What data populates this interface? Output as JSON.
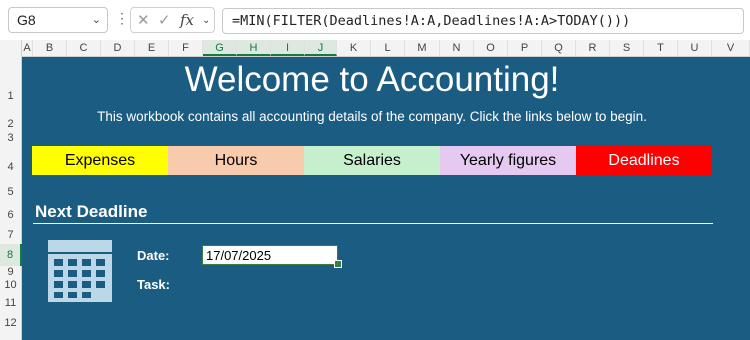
{
  "formula_bar": {
    "name_box": "G8",
    "formula": "=MIN(FILTER(Deadlines!A:A,Deadlines!A:A>TODAY()))"
  },
  "columns": [
    "A",
    "B",
    "C",
    "D",
    "E",
    "F",
    "G",
    "H",
    "I",
    "J",
    "K",
    "L",
    "M",
    "N",
    "O",
    "P",
    "Q",
    "R",
    "S",
    "T",
    "U",
    "V"
  ],
  "rows": [
    "1",
    "2",
    "3",
    "4",
    "5",
    "6",
    "7",
    "8",
    "9",
    "10",
    "11",
    "12"
  ],
  "sheet": {
    "title": "Welcome to Accounting!",
    "subtitle": "This workbook contains all accounting details of the company. Click the links below to begin.",
    "links": [
      {
        "label": "Expenses",
        "bg": "#ffff00",
        "color": "#000000"
      },
      {
        "label": "Hours",
        "bg": "#f8cbad",
        "color": "#000000"
      },
      {
        "label": "Salaries",
        "bg": "#c6efce",
        "color": "#000000"
      },
      {
        "label": "Yearly figures",
        "bg": "#e6c9f0",
        "color": "#000000"
      },
      {
        "label": "Deadlines",
        "bg": "#ff0000",
        "color": "#ffffff"
      }
    ],
    "section_title": "Next Deadline",
    "date_label": "Date:",
    "date_value": "17/07/2025",
    "task_label": "Task:"
  },
  "colors": {
    "sheet_bg": "#1b5c82",
    "selection": "#107c41"
  }
}
